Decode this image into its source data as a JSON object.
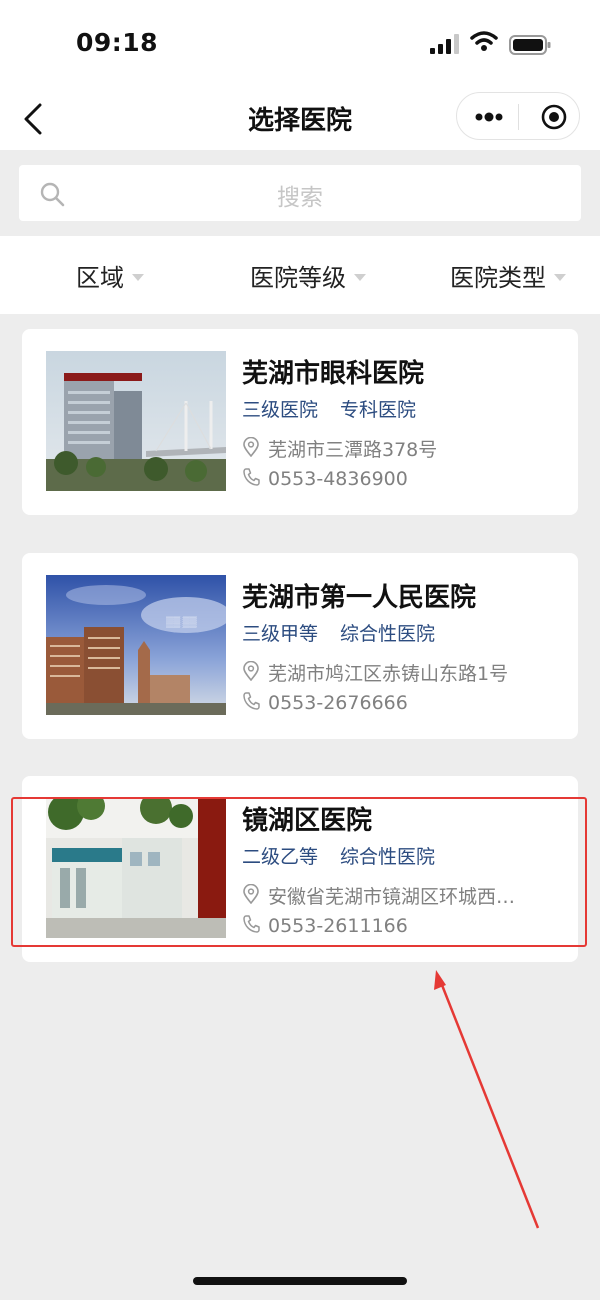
{
  "status": {
    "time": "09:18"
  },
  "nav": {
    "title": "选择医院"
  },
  "search": {
    "placeholder": "搜索"
  },
  "filters": [
    "区域",
    "医院等级",
    "医院类型"
  ],
  "hospitals": [
    {
      "name": "芜湖市眼科医院",
      "level": "三级医院",
      "type": "专科医院",
      "address": "芜湖市三潭路378号",
      "phone": "0553-4836900"
    },
    {
      "name": "芜湖市第一人民医院",
      "level": "三级甲等",
      "type": "综合性医院",
      "address": "芜湖市鸠江区赤铸山东路1号",
      "phone": "0553-2676666"
    },
    {
      "name": "镜湖区医院",
      "level": "二级乙等",
      "type": "综合性医院",
      "address": "安徽省芜湖市镜湖区环城西…",
      "phone": "0553-2611166"
    }
  ],
  "colors": {
    "accent_tag": "#2c4c80",
    "highlight": "#e53935"
  }
}
